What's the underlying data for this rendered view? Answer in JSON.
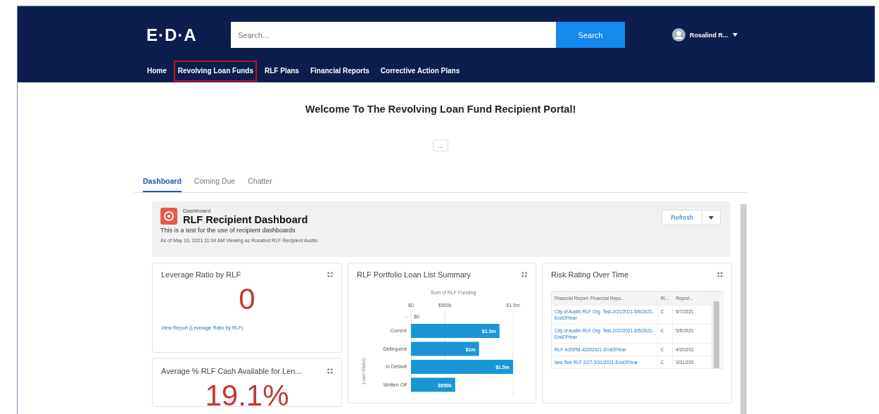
{
  "header": {
    "logo": "E·D·A",
    "search": {
      "placeholder": "Search..."
    },
    "search_button": "Search",
    "user": "Rosalind R...",
    "nav": [
      {
        "label": "Home",
        "highlighted": false
      },
      {
        "label": "Revolving Loan Funds",
        "highlighted": true
      },
      {
        "label": "RLF Plans",
        "highlighted": false
      },
      {
        "label": "Financial Reports",
        "highlighted": false
      },
      {
        "label": "Corrective Action Plans",
        "highlighted": false
      }
    ]
  },
  "welcome": "Welcome To The Revolving Loan Fund Recipient Portal!",
  "more_button": "...",
  "tabs": [
    {
      "label": "Dashboard",
      "selected": true
    },
    {
      "label": "Coming Due",
      "selected": false
    },
    {
      "label": "Chatter",
      "selected": false
    }
  ],
  "dashboard": {
    "eyebrow": "Dashboard",
    "title": "RLF Recipient Dashboard",
    "description": "This is a test for the use of recipient dashboards",
    "as_of": "As of May 10, 2021 11:04 AM Viewing as Rosalind RLF Recipient Austin",
    "refresh": "Refresh"
  },
  "widgets": [
    {
      "kind": "metric",
      "title": "Leverage Ratio by RLF",
      "value": "0",
      "link": "View Report (Leverage Ratio by RLF)"
    },
    {
      "kind": "bar",
      "title": "RLF Portfolio Loan List Summary",
      "chart_data": {
        "type": "bar",
        "orientation": "horizontal",
        "title": "Sum of RLF Funding",
        "ylabel": "Loan Status",
        "categories": [
          "-",
          "Current",
          "Delinquent",
          "In Default",
          "Written Off"
        ],
        "values": [
          0,
          1300000,
          1000000,
          1500000,
          650000
        ],
        "value_labels": [
          "$0",
          "$1.3m",
          "$1m",
          "$1.5m",
          "$650k"
        ],
        "xticks": [
          {
            "value": 0,
            "label": "$0"
          },
          {
            "value": 500000,
            "label": "$500k"
          },
          {
            "value": 1500000,
            "label": "$1.5m"
          }
        ],
        "xlim": [
          0,
          1500000
        ]
      }
    },
    {
      "kind": "table",
      "title": "Risk Rating Over Time",
      "columns": [
        "Financial Report: Financial Repo...",
        "Ri...",
        "Report..."
      ],
      "rows": [
        [
          "City of Austin RLF Org. Test-2/21/2021-5/6/2021-EndOfYear",
          "C",
          "5/7/2021"
        ],
        [
          "City of Austin RLF Org. Test-2/22/2021-5/5/2021-EndOfYear",
          "C",
          "5/5/2021"
        ],
        [
          "RLF 4/20PM-4/20/2021-EndOfYear",
          "C",
          "4/20/202"
        ],
        [
          "Iara Test RLF 2/27-3/31/2021-EndOfYear",
          "C",
          "3/31/202"
        ]
      ]
    },
    {
      "kind": "metric",
      "title": "Average % RLF Cash Available for Len...",
      "value": "19.1%"
    }
  ]
}
